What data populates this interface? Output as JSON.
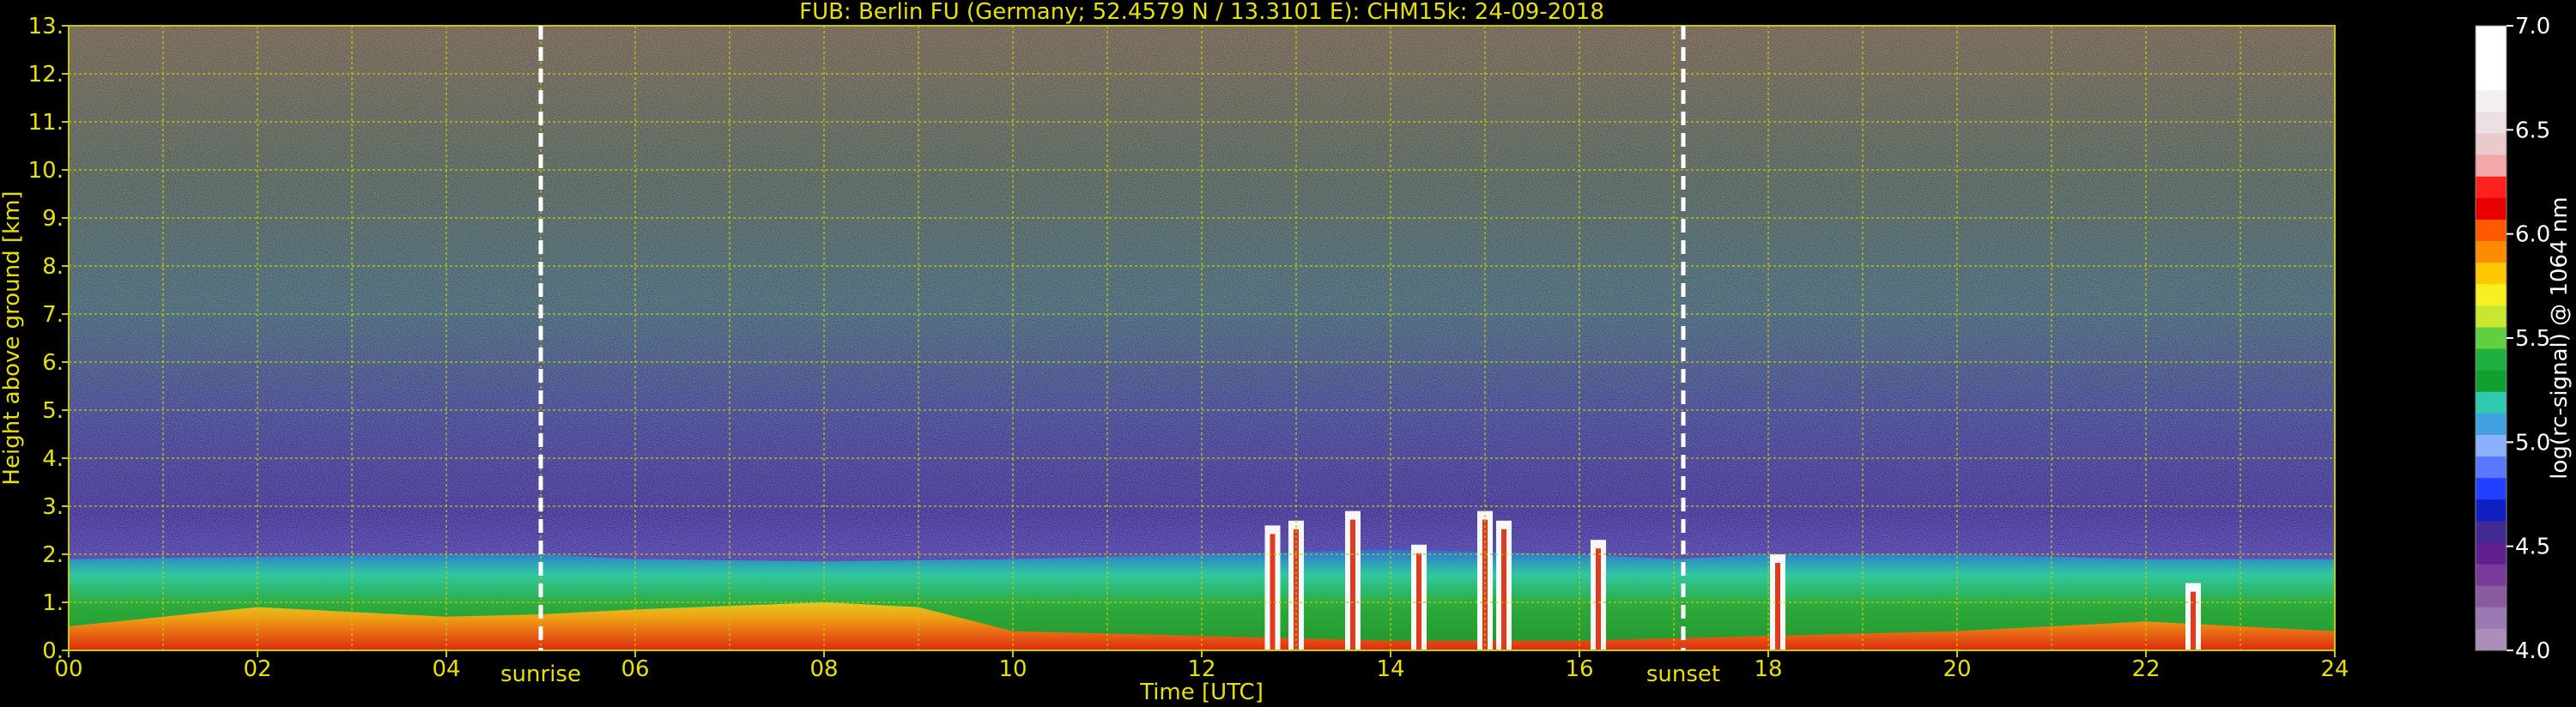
{
  "chart_data": {
    "type": "heatmap",
    "title": "FUB: Berlin FU (Germany; 52.4579 N / 13.3101 E):    CHM15k: 24-09-2018",
    "xlabel": "Time [UTC]",
    "ylabel": "Height above ground [km]",
    "xlim": [
      0,
      24
    ],
    "ylim": [
      0,
      13
    ],
    "x_ticks": [
      "00",
      "02",
      "04",
      "06",
      "08",
      "10",
      "12",
      "14",
      "16",
      "18",
      "20",
      "22",
      "24"
    ],
    "y_ticks": [
      "0.",
      "1.",
      "2.",
      "3.",
      "4.",
      "5.",
      "6.",
      "7.",
      "8.",
      "9.",
      "10.",
      "11.",
      "12.",
      "13."
    ],
    "grid": true,
    "markers": [
      {
        "label": "sunrise",
        "x": 5.0
      },
      {
        "label": "sunset",
        "x": 17.1
      }
    ],
    "colorbar": {
      "label": "log(rc-signal) @ 1064 nm",
      "range": [
        4.0,
        7.0
      ],
      "ticks": [
        "4.0",
        "4.5",
        "5.0",
        "5.5",
        "6.0",
        "6.5",
        "7.0"
      ]
    },
    "boundary_layer_top_km": [
      [
        0,
        1.9
      ],
      [
        2,
        1.95
      ],
      [
        4,
        2.0
      ],
      [
        5,
        2.0
      ],
      [
        6,
        1.9
      ],
      [
        8,
        1.85
      ],
      [
        10,
        1.9
      ],
      [
        12,
        2.0
      ],
      [
        14,
        2.1
      ],
      [
        16,
        2.0
      ],
      [
        17,
        1.9
      ],
      [
        18,
        2.0
      ],
      [
        20,
        2.0
      ],
      [
        22,
        1.9
      ],
      [
        24,
        1.9
      ]
    ],
    "aerosol_layer_top_km": [
      [
        0,
        0.5
      ],
      [
        2,
        0.9
      ],
      [
        4,
        0.7
      ],
      [
        5,
        0.75
      ],
      [
        6,
        0.85
      ],
      [
        8,
        1.0
      ],
      [
        9,
        0.9
      ],
      [
        10,
        0.4
      ],
      [
        12,
        0.3
      ],
      [
        14,
        0.2
      ],
      [
        16,
        0.2
      ],
      [
        18,
        0.3
      ],
      [
        20,
        0.4
      ],
      [
        22,
        0.6
      ],
      [
        24,
        0.4
      ]
    ],
    "clouds": [
      {
        "x": 12.75,
        "height_km": 2.6
      },
      {
        "x": 13.0,
        "height_km": 2.7
      },
      {
        "x": 13.6,
        "height_km": 2.9
      },
      {
        "x": 14.3,
        "height_km": 2.2
      },
      {
        "x": 15.0,
        "height_km": 2.9
      },
      {
        "x": 15.2,
        "height_km": 2.7
      },
      {
        "x": 16.2,
        "height_km": 2.3
      },
      {
        "x": 18.1,
        "height_km": 2.0
      },
      {
        "x": 22.5,
        "height_km": 1.4
      }
    ]
  }
}
